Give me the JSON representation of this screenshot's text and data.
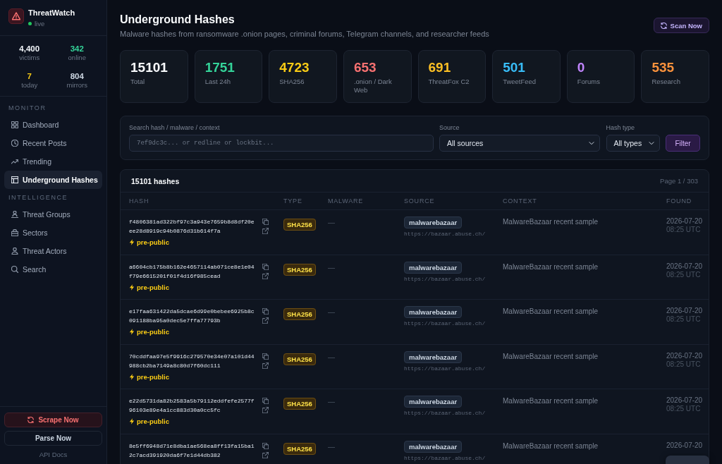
{
  "sidebar": {
    "brand": {
      "name": "ThreatWatch",
      "status": "live"
    },
    "stats": [
      {
        "value": "4,400",
        "label": "victims",
        "color": "#f1f5f9"
      },
      {
        "value": "342",
        "label": "online",
        "color": "#34d399"
      },
      {
        "value": "7",
        "label": "today",
        "color": "#facc15"
      },
      {
        "value": "804",
        "label": "mirrors",
        "color": "#cbd5e1"
      }
    ],
    "sections": [
      {
        "title": "MONITOR",
        "items": [
          {
            "label": "Dashboard",
            "selected": false
          },
          {
            "label": "Recent Posts",
            "selected": false
          },
          {
            "label": "Trending",
            "selected": false
          },
          {
            "label": "Underground Hashes",
            "selected": true
          }
        ]
      },
      {
        "title": "INTELLIGENCE",
        "items": [
          {
            "label": "Threat Groups",
            "selected": false
          },
          {
            "label": "Sectors",
            "selected": false
          },
          {
            "label": "Threat Actors",
            "selected": false
          },
          {
            "label": "Search",
            "selected": false
          }
        ]
      }
    ],
    "actions": [
      {
        "label": "Scrape Now",
        "kind": "danger"
      },
      {
        "label": "Parse Now",
        "kind": "plain"
      }
    ],
    "footer_link": "API Docs"
  },
  "header": {
    "title": "Underground Hashes",
    "subtitle": "Malware hashes from ransomware .onion pages, criminal forums, Telegram channels, and researcher feeds",
    "button": "Scan Now"
  },
  "stats": [
    {
      "value": "15101",
      "label": "Total",
      "color": "#f8fafc"
    },
    {
      "value": "1751",
      "label": "Last 24h",
      "color": "#34d399"
    },
    {
      "value": "4723",
      "label": "SHA256",
      "color": "#facc15"
    },
    {
      "value": "653",
      "label": ".onion / Dark Web",
      "color": "#f87171"
    },
    {
      "value": "691",
      "label": "ThreatFox C2",
      "color": "#fbbf24"
    },
    {
      "value": "501",
      "label": "TweetFeed",
      "color": "#38bdf8"
    },
    {
      "value": "0",
      "label": "Forums",
      "color": "#c084fc"
    },
    {
      "value": "535",
      "label": "Research",
      "color": "#fb923c"
    }
  ],
  "filters": {
    "search": {
      "label": "Search hash / malware / context",
      "placeholder": "7ef9dc3c... or redline or lockbit..."
    },
    "source": {
      "label": "Source",
      "value": "All sources"
    },
    "hash_type": {
      "label": "Hash type",
      "value": "All types"
    },
    "button": "Filter"
  },
  "table": {
    "count": "15101 hashes",
    "page": "Page 1 / 303",
    "columns": [
      "HASH",
      "TYPE",
      "MALWARE",
      "SOURCE",
      "CONTEXT",
      "FOUND"
    ],
    "rows": [
      {
        "hash": "f4806381ad322bf97c3a943e7659b8d8df20eee28d8919c94b0876d31b614f7a",
        "tag": "pre-public",
        "type": "SHA256",
        "malware": "—",
        "source": "malwarebazaar",
        "source_url": "https://bazaar.abuse.ch/",
        "context": "MalwareBazaar recent sample",
        "found_date": "2026-07-20",
        "found_time": "08:25 UTC"
      },
      {
        "hash": "a6604cb175b8b162e4657114ab071ce8e1e04f79e6615201f01f4d16f985cead",
        "tag": "pre-public",
        "type": "SHA256",
        "malware": "—",
        "source": "malwarebazaar",
        "source_url": "https://bazaar.abuse.ch/",
        "context": "MalwareBazaar recent sample",
        "found_date": "2026-07-20",
        "found_time": "08:25 UTC"
      },
      {
        "hash": "e17faa631422da5dcae6d99e0bebee6925b8c091188ba95a0dec5e7ffa77793b",
        "tag": "pre-public",
        "type": "SHA256",
        "malware": "—",
        "source": "malwarebazaar",
        "source_url": "https://bazaar.abuse.ch/",
        "context": "MalwareBazaar recent sample",
        "found_date": "2026-07-20",
        "found_time": "08:25 UTC"
      },
      {
        "hash": "70cddfaa97e5f9916c279570e34e07a101d44988cb2ba7149a8c80d7f60dc111",
        "tag": "pre-public",
        "type": "SHA256",
        "malware": "—",
        "source": "malwarebazaar",
        "source_url": "https://bazaar.abuse.ch/",
        "context": "MalwareBazaar recent sample",
        "found_date": "2026-07-20",
        "found_time": "08:25 UTC"
      },
      {
        "hash": "e22d5731da82b2583a5b79112eddfefe2577f96103e89e4a1cc883d30a0cc5fc",
        "tag": "pre-public",
        "type": "SHA256",
        "malware": "—",
        "source": "malwarebazaar",
        "source_url": "https://bazaar.abuse.ch/",
        "context": "MalwareBazaar recent sample",
        "found_date": "2026-07-20",
        "found_time": "08:25 UTC"
      },
      {
        "hash": "8e5ff6948d71e8dba1ae568ea8ff13fa15ba12c7acd391920da6f7e1d44db382",
        "type": "SHA256",
        "malware": "—",
        "source": "malwarebazaar",
        "source_url": "https://bazaar.abuse.ch/",
        "context": "MalwareBazaar recent sample",
        "found_date": "2026-07-20"
      }
    ]
  },
  "toast": {
    "visible": true
  }
}
